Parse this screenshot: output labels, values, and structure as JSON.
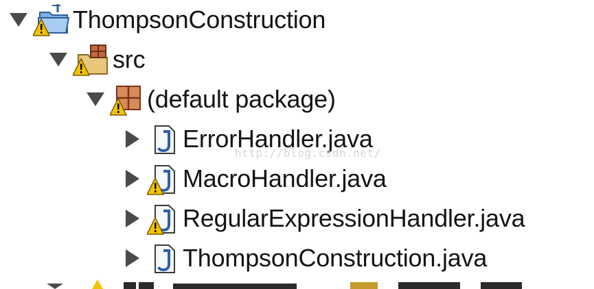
{
  "tree": {
    "project": {
      "label": "ThompsonConstruction"
    },
    "src": {
      "label": "src"
    },
    "package": {
      "label": "(default package)"
    },
    "files": [
      {
        "label": "ErrorHandler.java",
        "warning": false
      },
      {
        "label": "MacroHandler.java",
        "warning": true
      },
      {
        "label": "RegularExpressionHandler.java",
        "warning": true
      },
      {
        "label": "ThompsonConstruction.java",
        "warning": false
      }
    ]
  },
  "watermark": "http://blog.csdn.net/",
  "colors": {
    "warning": "#f2c400",
    "java_icon": "#2d5fa8",
    "folder": "#7fb0e6",
    "package": "#b3562e"
  }
}
